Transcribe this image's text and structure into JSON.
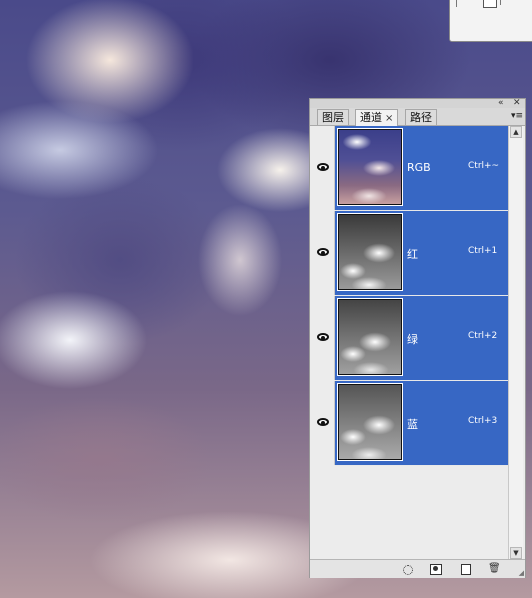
{
  "app": {
    "tabs": [
      "图层",
      "通道",
      "路径"
    ],
    "active_tab_index": 1,
    "tab_close_glyph": "×",
    "panel_controls": [
      "«",
      "✕"
    ],
    "menu_glyph": "▾≡"
  },
  "channels": [
    {
      "name": "RGB",
      "shortcut": "Ctrl+~",
      "visible": true,
      "thumb_icon": "rgb-composite-thumbnail"
    },
    {
      "name": "红",
      "shortcut": "Ctrl+1",
      "visible": true,
      "thumb_icon": "red-channel-thumbnail"
    },
    {
      "name": "绿",
      "shortcut": "Ctrl+2",
      "visible": true,
      "thumb_icon": "green-channel-thumbnail"
    },
    {
      "name": "蓝",
      "shortcut": "Ctrl+3",
      "visible": true,
      "thumb_icon": "blue-channel-thumbnail"
    }
  ],
  "bottom_icons": [
    "load-selection-icon",
    "save-selection-icon",
    "new-channel-icon",
    "delete-channel-icon"
  ],
  "colors": {
    "selection": "#3767c4",
    "panel_bg": "#ececec"
  }
}
